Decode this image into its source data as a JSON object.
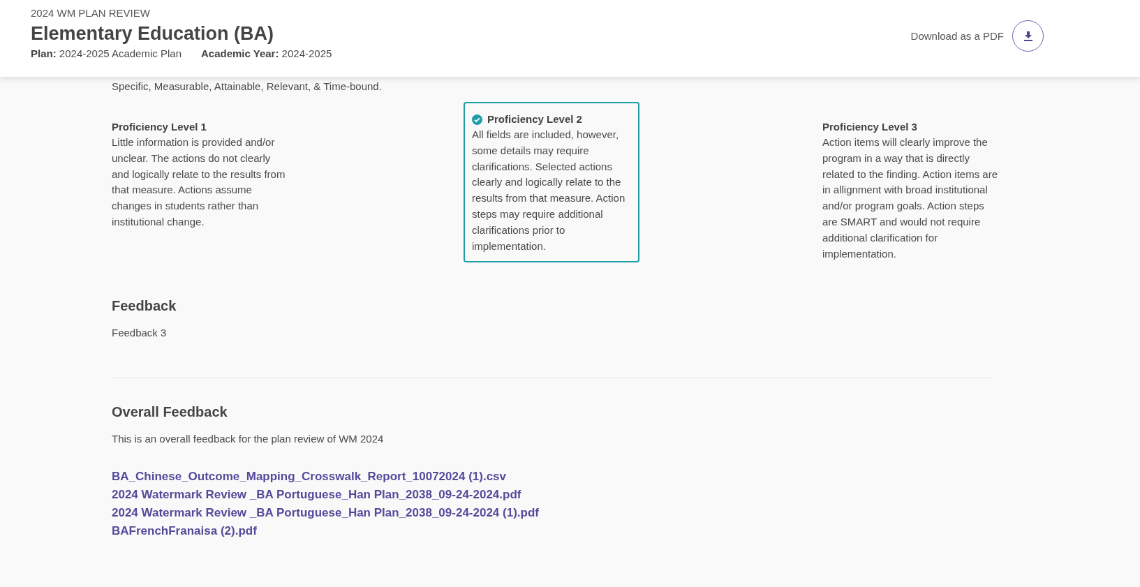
{
  "header": {
    "overline": "2024 WM PLAN REVIEW",
    "title": "Elementary Education (BA)",
    "meta": [
      {
        "label": "Plan:",
        "value": "2024-2025 Academic Plan"
      },
      {
        "label": "Academic Year:",
        "value": "2024-2025"
      }
    ],
    "download_label": "Download as a PDF"
  },
  "intro": "Specific, Measurable, Attainable, Relevant, & Time-bound.",
  "levels": [
    {
      "title": "Proficiency Level 1",
      "text": "Little information is provided and/or unclear. The actions do not clearly and logically relate to the results from that measure. Actions assume changes in students rather than institutional change.",
      "selected": false
    },
    {
      "title": "Proficiency Level 2",
      "text": "All fields are included, however, some details may require clarifications. Selected actions clearly and logically relate to the results from that measure. Action steps may require additional clarifications prior to implementation.",
      "selected": true
    },
    {
      "title": "Proficiency Level 3",
      "text": "Action items will clearly improve the program in a way that is directly related to the finding. Action items are in allignment with broad institutional and/or program goals. Action steps are SMART and would not require additional clarification for implementation.",
      "selected": false
    }
  ],
  "feedback": {
    "heading": "Feedback",
    "text": "Feedback 3"
  },
  "overall": {
    "heading": "Overall Feedback",
    "text": "This is an overall feedback for the plan review of WM 2024"
  },
  "files": [
    "BA_Chinese_Outcome_Mapping_Crosswalk_Report_10072024 (1).csv",
    "2024 Watermark Review _BA Portuguese_Han Plan_2038_09-24-2024.pdf",
    "2024 Watermark Review _BA Portuguese_Han Plan_2038_09-24-2024 (1).pdf",
    "BAFrenchFranaisa (2).pdf"
  ]
}
